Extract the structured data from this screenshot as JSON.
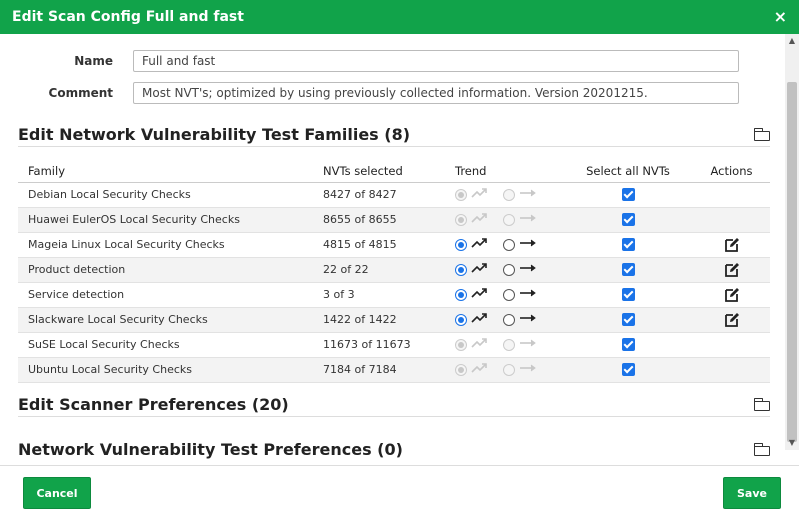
{
  "dialog": {
    "title": "Edit Scan Config Full and fast",
    "close_glyph": "×"
  },
  "form": {
    "name_label": "Name",
    "name_value": "Full and fast",
    "comment_label": "Comment",
    "comment_value": "Most NVT's; optimized by using previously collected information. Version 20201215."
  },
  "families_section": {
    "title": "Edit Network Vulnerability Test Families (8)",
    "icon": "folder-icon",
    "columns": {
      "family": "Family",
      "nvts": "NVTs selected",
      "trend": "Trend",
      "select_all": "Select all NVTs",
      "actions": "Actions"
    },
    "rows": [
      {
        "family": "Debian Local Security Checks",
        "nvts": "8427 of 8427",
        "trend_enabled": false,
        "select_all": true,
        "editable": false
      },
      {
        "family": "Huawei EulerOS Local Security Checks",
        "nvts": "8655 of 8655",
        "trend_enabled": false,
        "select_all": true,
        "editable": false
      },
      {
        "family": "Mageia Linux Local Security Checks",
        "nvts": "4815 of 4815",
        "trend_enabled": true,
        "select_all": true,
        "editable": true
      },
      {
        "family": "Product detection",
        "nvts": "22 of 22",
        "trend_enabled": true,
        "select_all": true,
        "editable": true
      },
      {
        "family": "Service detection",
        "nvts": "3 of 3",
        "trend_enabled": true,
        "select_all": true,
        "editable": true
      },
      {
        "family": "Slackware Local Security Checks",
        "nvts": "1422 of 1422",
        "trend_enabled": true,
        "select_all": true,
        "editable": true
      },
      {
        "family": "SuSE Local Security Checks",
        "nvts": "11673 of 11673",
        "trend_enabled": false,
        "select_all": true,
        "editable": false
      },
      {
        "family": "Ubuntu Local Security Checks",
        "nvts": "7184 of 7184",
        "trend_enabled": false,
        "select_all": true,
        "editable": false
      }
    ]
  },
  "scanner_section": {
    "title": "Edit Scanner Preferences (20)"
  },
  "nvt_prefs_section": {
    "title": "Network Vulnerability Test Preferences (0)"
  },
  "footer": {
    "cancel_label": "Cancel",
    "save_label": "Save"
  },
  "colors": {
    "brand_green": "#11a34a",
    "checkbox_blue": "#1a73e8"
  }
}
